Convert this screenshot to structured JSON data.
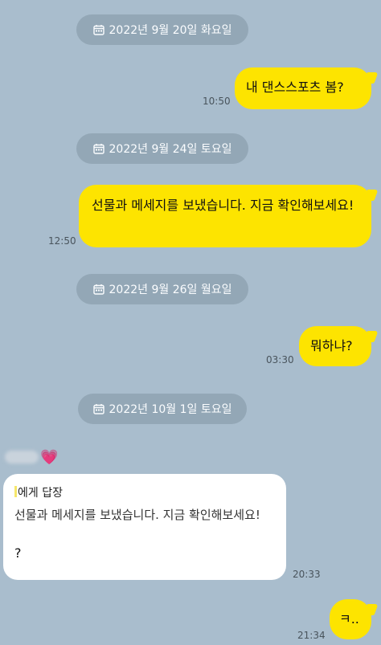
{
  "dates": [
    "2022년 9월 20일 화요일",
    "2022년 9월 24일 토요일",
    "2022년 9월 26일 월요일",
    "2022년 10월 1일 토요일"
  ],
  "messages": [
    {
      "text": "내 댄스스포츠 봄?",
      "time": "10:50"
    },
    {
      "text": "선물과 메세지를 보냈습니다. 지금 확인해보세요!",
      "time": "12:50"
    },
    {
      "text": "뭐하냐?",
      "time": "03:30"
    },
    {
      "text": "ㅋ..",
      "time": "21:34"
    }
  ],
  "incoming": {
    "heart": "💗",
    "reply_header": "에게 답장",
    "reply_quote": "선물과 메세지를 보냈습니다. 지금 확인해보세요!",
    "body": "?",
    "time": "20:33"
  },
  "colors": {
    "background": "#a9bdcd",
    "my_bubble": "#fde400",
    "incoming_bubble": "#ffffff",
    "date_pill": "#93a7b6"
  }
}
